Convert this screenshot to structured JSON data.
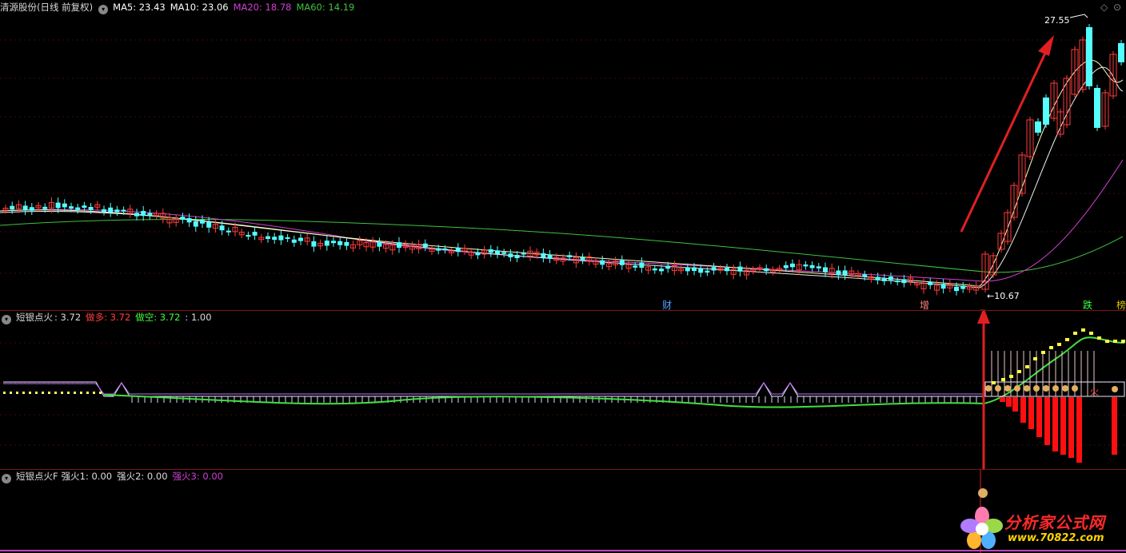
{
  "main": {
    "stock_title": "清源股份(日线 前复权)",
    "ma": [
      {
        "label": "MA5: 23.43",
        "color": "#ffffff"
      },
      {
        "label": "MA10: 23.06",
        "color": "#ffffff"
      },
      {
        "label": "MA20: 18.78",
        "color": "#d040d0"
      },
      {
        "label": "MA60: 14.19",
        "color": "#40c040"
      }
    ],
    "high_label": "27.55",
    "low_label": "←10.67",
    "markers": [
      {
        "text": "财",
        "color": "#4fa3ff"
      },
      {
        "text": "增",
        "color": "#ff8080"
      },
      {
        "text": "跌",
        "color": "#40ff40"
      },
      {
        "text": "榜",
        "color": "#e0c000"
      }
    ],
    "mini_icons": [
      "◇",
      "⊙"
    ]
  },
  "ind1": {
    "name": "短银点火",
    "v0": ": 3.72",
    "duo": "做多: 3.72",
    "kong": "做空: 3.72",
    "v3": ": 1.00",
    "note": "火"
  },
  "ind2": {
    "name": "短银点火F",
    "q1": "强火1: 0.00",
    "q2": "强火2: 0.00",
    "q3": "强火3: 0.00"
  },
  "watermark": {
    "cn": "分析家公式网",
    "url": "www.70822.com"
  },
  "colors": {
    "up": "#ff3c3c",
    "down": "#54ffff",
    "ma5": "#ffffff",
    "ma20": "#d040d0",
    "ma60": "#40c040"
  }
}
